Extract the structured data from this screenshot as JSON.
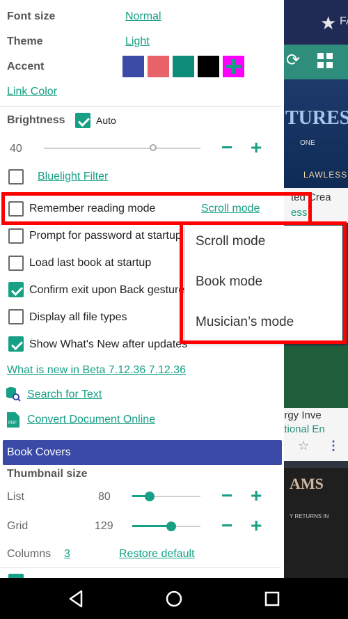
{
  "colors": {
    "accent": "#17A085",
    "section": "#3A4AA6",
    "highlight": "#FF0000"
  },
  "settings": {
    "font_size_label": "Font size",
    "font_size_value": "Normal",
    "theme_label": "Theme",
    "theme_value": "Light",
    "accent_label": "Accent",
    "accent_swatches": [
      "#3B4BA6",
      "#E8626A",
      "#0E8C7A",
      "#000000",
      "#FF00FF"
    ],
    "link_color": "Link Color",
    "brightness_label": "Brightness",
    "brightness_auto": "Auto",
    "brightness_value": "40",
    "bluelight_filter": "Bluelight Filter",
    "remember_reading_mode": "Remember reading mode",
    "reading_mode_value": "Scroll mode",
    "prompt_password": "Prompt for password at startup",
    "load_last_book": "Load last book at startup",
    "confirm_exit": "Confirm exit upon Back gesture",
    "display_all_types": "Display all file types",
    "show_whats_new": "Show What's New after updates",
    "whats_new_link": "What is new in Beta 7.12.36 7.12.36",
    "search_text": "Search for Text",
    "convert_document": "Convert Document Online"
  },
  "book_covers": {
    "section_title": "Book Covers",
    "thumbnail_size": "Thumbnail size",
    "list_label": "List",
    "list_value": "80",
    "grid_label": "Grid",
    "grid_value": "129",
    "columns_label": "Columns",
    "columns_value": "3",
    "restore_default": "Restore default"
  },
  "dropdown": {
    "options": [
      "Scroll mode",
      "Book mode",
      "Musician’s mode"
    ]
  },
  "background": {
    "star_text": "FA",
    "cover1_title": "TURES",
    "cover1_line": "ONE",
    "cover1_author": "LAWLESS",
    "card1_a": "ted Crea",
    "card1_b": "ess",
    "card2_a": "ergy Inve",
    "card2_b": "ational En",
    "cover3_title": "AMS",
    "cover3_sub": "Y RETURNS IN"
  },
  "icons": {
    "back": "back-triangle-icon",
    "home": "home-circle-icon",
    "recents": "recents-square-icon"
  }
}
